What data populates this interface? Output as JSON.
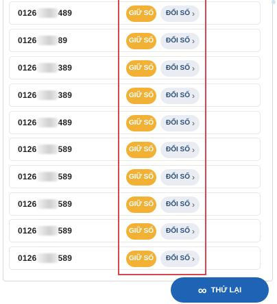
{
  "rows": [
    {
      "prefix": "0126",
      "suffix": "489",
      "keep": "GIỮ SỐ",
      "change": "ĐỔI SỐ"
    },
    {
      "prefix": "0126",
      "suffix": "89",
      "keep": "GIỮ SỐ",
      "change": "ĐỔI SỐ"
    },
    {
      "prefix": "0126",
      "suffix": "389",
      "keep": "GIỮ SỐ",
      "change": "ĐỔI SỐ"
    },
    {
      "prefix": "0126",
      "suffix": "389",
      "keep": "GIỮ SỐ",
      "change": "ĐỔI SỐ"
    },
    {
      "prefix": "0126",
      "suffix": "489",
      "keep": "GIỮ SỐ",
      "change": "ĐỔI SỐ"
    },
    {
      "prefix": "0126",
      "suffix": "589",
      "keep": "GIỮ SỐ",
      "change": "ĐỔI SỐ"
    },
    {
      "prefix": "0126",
      "suffix": "589",
      "keep": "GIỮ SỐ",
      "change": "ĐỔI SỐ"
    },
    {
      "prefix": "0126",
      "suffix": "589",
      "keep": "GIỮ SỐ",
      "change": "ĐỔI SỐ"
    },
    {
      "prefix": "0126",
      "suffix": "589",
      "keep": "GIỮ SỐ",
      "change": "ĐỔI SỐ"
    },
    {
      "prefix": "0126",
      "suffix": "589",
      "keep": "GIỮ SỐ",
      "change": "ĐỔI SỐ"
    }
  ],
  "retry_label": "THỬ LẠI",
  "colors": {
    "keep": "#f2b134",
    "change_bg": "#e9edf3",
    "retry": "#1f64b4",
    "highlight": "#d9434d"
  },
  "icons": {
    "chevron": "chevron-right-icon",
    "retry": "infinity-icon"
  }
}
